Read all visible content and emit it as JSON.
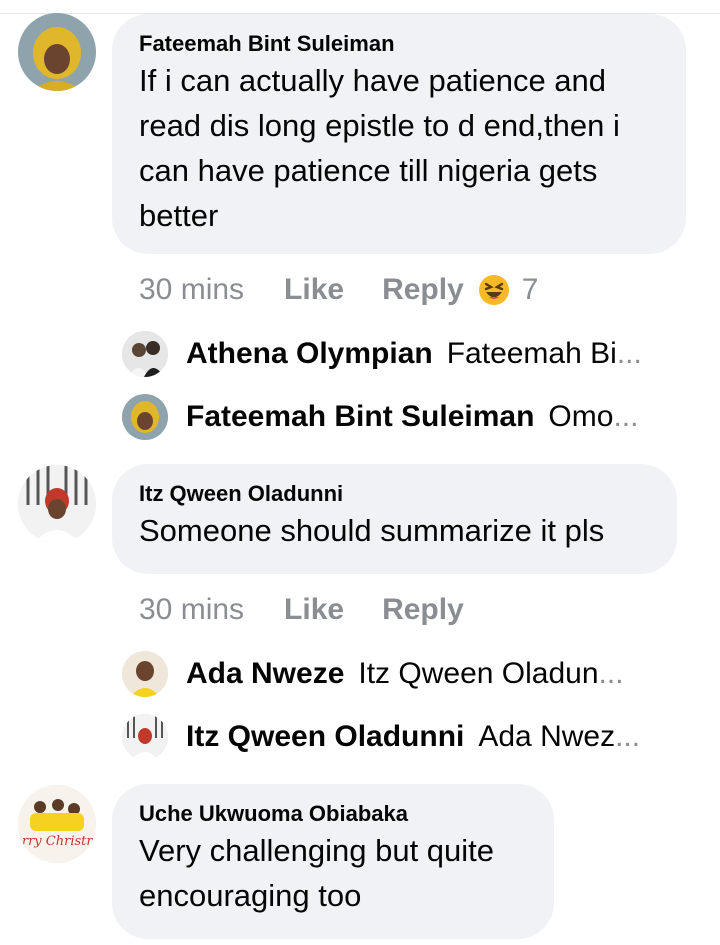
{
  "comments": [
    {
      "author": "Fateemah Bint Suleiman",
      "text_lines": [
        "If i can actually have patience and",
        "read dis long epistle to d end,then i",
        "can have patience till nigeria gets",
        "better"
      ],
      "time": "30 mins",
      "like_label": "Like",
      "reply_label": "Reply",
      "reaction_count": "7",
      "reaction_icon": "laughing-emoji-icon",
      "replies": [
        {
          "name": "Athena Olympian",
          "snippet": "Fateemah Bi",
          "ellipsis": "..."
        },
        {
          "name": "Fateemah Bint Suleiman",
          "snippet": "Omo",
          "ellipsis": "..."
        }
      ]
    },
    {
      "author": "Itz Qween Oladunni",
      "text_lines": [
        "Someone should summarize it pls"
      ],
      "time": "30 mins",
      "like_label": "Like",
      "reply_label": "Reply",
      "replies": [
        {
          "name": "Ada Nweze",
          "snippet": "Itz Qween Oladun",
          "ellipsis": "..."
        },
        {
          "name": "Itz Qween Oladunni",
          "snippet": "Ada Nwez",
          "ellipsis": "..."
        }
      ]
    },
    {
      "author": "Uche Ukwuoma Obiabaka",
      "text_lines": [
        "Very challenging but quite",
        "encouraging too"
      ],
      "avatar_text": "Merry Christmas"
    }
  ],
  "colors": {
    "bubble": "#f0f2f5",
    "meta": "#8a8d91",
    "text": "#050505",
    "emoji": "#f7b928"
  }
}
